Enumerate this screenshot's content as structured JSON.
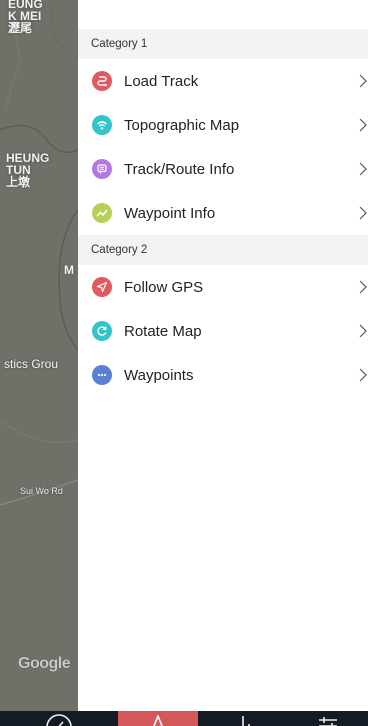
{
  "map": {
    "labels": [
      {
        "text": "EUNG\nK MEI\n瀝尾"
      },
      {
        "text": "HEUNG\nTUN\n上墩"
      },
      {
        "text": "M"
      },
      {
        "text": "stics Grou"
      },
      {
        "text": "Sui Wo Rd"
      }
    ],
    "attribution": "Google"
  },
  "menu": {
    "categories": [
      {
        "title": "Category 1",
        "items": [
          {
            "label": "Load Track",
            "icon": "load-track-icon",
            "color": "#e05a5f"
          },
          {
            "label": "Topographic Map",
            "icon": "wifi-icon",
            "color": "#33c4c9"
          },
          {
            "label": "Track/Route Info",
            "icon": "message-icon",
            "color": "#b477e0"
          },
          {
            "label": "Waypoint Info",
            "icon": "trend-icon",
            "color": "#b5d155"
          }
        ]
      },
      {
        "title": "Category 2",
        "items": [
          {
            "label": "Follow GPS",
            "icon": "navigation-arrow-icon",
            "color": "#e05a5f"
          },
          {
            "label": "Rotate Map",
            "icon": "rotate-icon",
            "color": "#33c4c9"
          },
          {
            "label": "Waypoints",
            "icon": "more-dots-icon",
            "color": "#5b7fd6"
          }
        ]
      }
    ]
  },
  "bottom_tabs": [
    {
      "icon": "compass-icon",
      "active": false
    },
    {
      "icon": "navigation-icon",
      "active": true
    },
    {
      "icon": "stats-bars-icon",
      "active": false
    },
    {
      "icon": "settings-sliders-icon",
      "active": false
    }
  ],
  "colors": {
    "accent": "#d4575a",
    "bottom_bar": "#151b24",
    "section_header_bg": "#f3f3f3"
  }
}
